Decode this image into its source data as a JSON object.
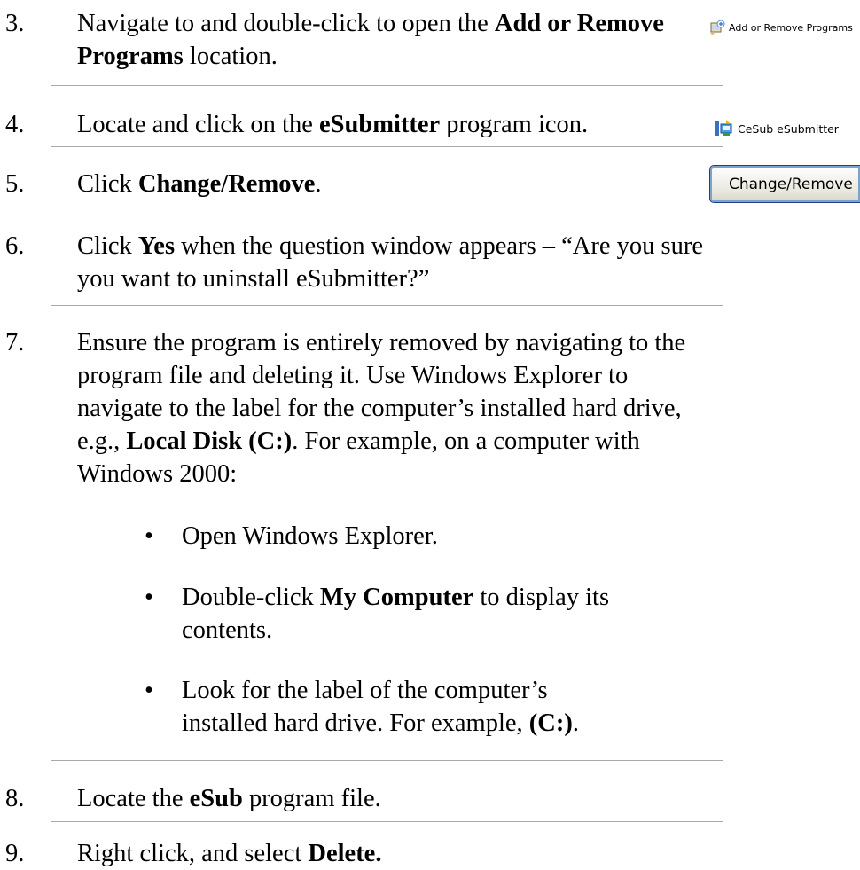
{
  "steps": [
    {
      "num": "3.",
      "pre": "Navigate to and double-click to open the ",
      "bold": "Add or Remove Programs",
      "post": " location."
    },
    {
      "num": "4.",
      "pre": "Locate and click on the ",
      "bold": "eSubmitter",
      "post": " program icon."
    },
    {
      "num": "5.",
      "pre": "Click ",
      "bold": "Change/Remove",
      "post": "."
    },
    {
      "num": "6.",
      "pre": "Click ",
      "bold": "Yes",
      "post": " when the question window appears – “Are you sure you want to uninstall eSubmitter?”"
    },
    {
      "num": "7.",
      "pre": "Ensure the program is entirely removed by navigating to the program file and deleting it. Use Windows Explorer to navigate to the label for the computer’s installed hard drive, e.g., ",
      "bold": "Local Disk (C:)",
      "post": ".  For example, on a computer with Windows 2000:"
    },
    {
      "num": "8.",
      "pre": "Locate the ",
      "bold": "eSub",
      "post": " program file."
    },
    {
      "num": "9.",
      "pre": "Right click, and select ",
      "bold": "Delete.",
      "post": ""
    }
  ],
  "bullets": [
    {
      "pre": "Open Windows Explorer.",
      "bold": "",
      "post": ""
    },
    {
      "pre": "Double-click ",
      "bold": "My Computer",
      "post": " to display its contents."
    },
    {
      "pre": "Look for the label of the computer’s installed hard drive.  For example, ",
      "bold": "(C:)",
      "post": "."
    }
  ],
  "bullet_glyph": "•",
  "screenshots": {
    "add_remove_label": "Add or Remove Programs",
    "add_remove_icon": "add-remove-programs-icon",
    "esub_label": "CeSub eSubmitter",
    "esub_icon": "installer-icon",
    "button_label": "Change/Remove"
  }
}
